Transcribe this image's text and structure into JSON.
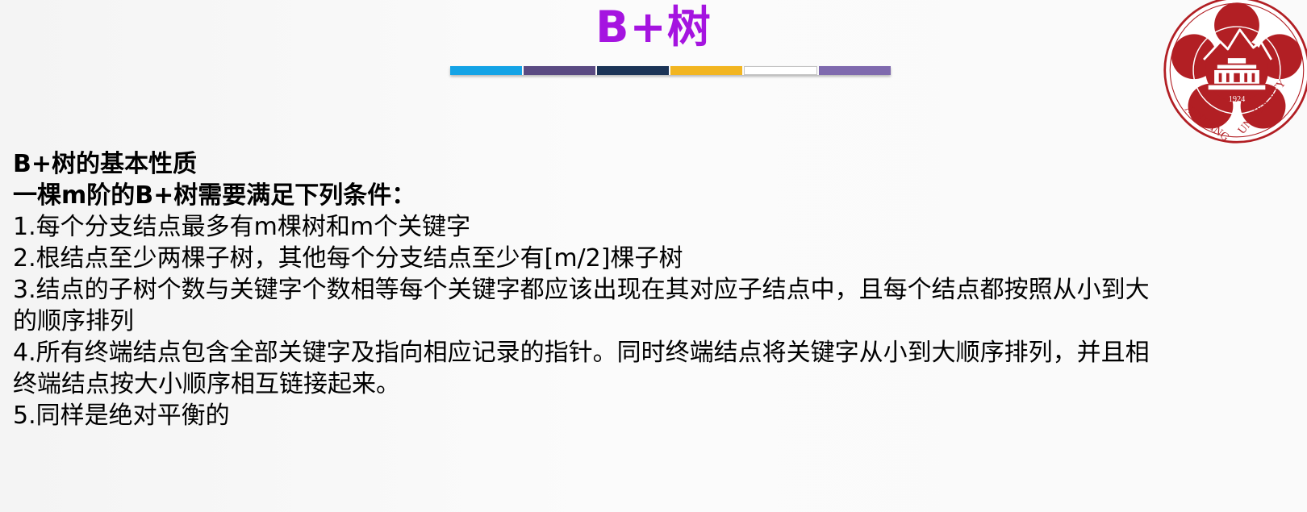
{
  "slide": {
    "title": "B+树",
    "title_color": "#a514e0",
    "accent_bar": {
      "colors": [
        "#14a3e6",
        "#5a4a82",
        "#1b3457",
        "#f2b521",
        "#ffffff",
        "#7f6aae"
      ]
    },
    "logo": {
      "name": "xinjiang-university-seal",
      "color": "#b21f24",
      "text_left": "XINJIANG",
      "text_right": "UNIVERSITY",
      "year": "1924"
    },
    "heading1": "B+树的基本性质",
    "heading2": "一棵m阶的B+树需要满足下列条件：",
    "items": [
      "1.每个分支结点最多有m棵树和m个关键字",
      "2.根结点至少两棵子树，其他每个分支结点至少有[m/2]棵子树",
      "3.结点的子树个数与关键字个数相等每个关键字都应该出现在其对应子结点中，且每个结点都按照从小到大",
      "的顺序排列",
      "4.所有终端结点包含全部关键字及指向相应记录的指针。同时终端结点将关键字从小到大顺序排列，并且相",
      "终端结点按大小顺序相互链接起来。",
      "5.同样是绝对平衡的"
    ]
  }
}
